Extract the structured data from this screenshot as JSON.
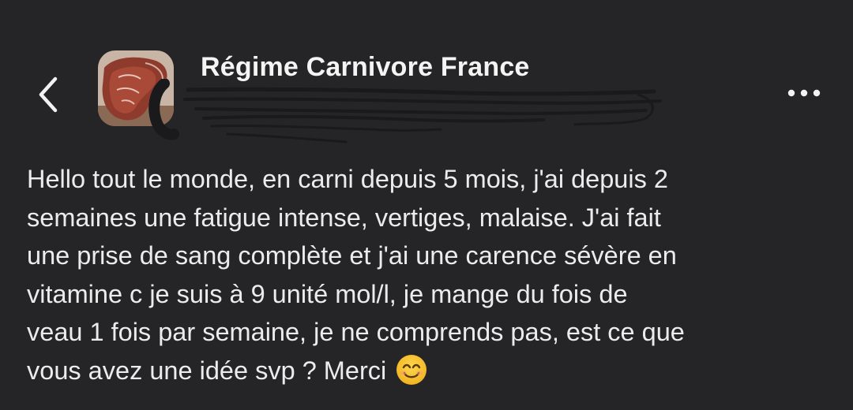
{
  "header": {
    "group_name": "Régime Carnivore France",
    "back_icon": "chevron-left-icon",
    "more_icon": "ellipsis-icon",
    "avatar": "group-avatar-meat-photo"
  },
  "post": {
    "body_lines": [
      "Hello tout le monde, en carni depuis 5 mois, j'ai depuis 2",
      "semaines une fatigue intense, vertiges, malaise. J'ai fait",
      "une prise de sang complète et j'ai une carence sévère en",
      "vitamine c je suis à 9 unité mol/l, je mange du fois de",
      "veau 1 fois par semaine, je ne comprends pas, est ce que",
      "vous avez une idée svp ? Merci"
    ],
    "emoji": "smiling-face-icon"
  },
  "colors": {
    "background": "#252527",
    "text": "#ececec",
    "emoji_fill": "#f7c531"
  }
}
